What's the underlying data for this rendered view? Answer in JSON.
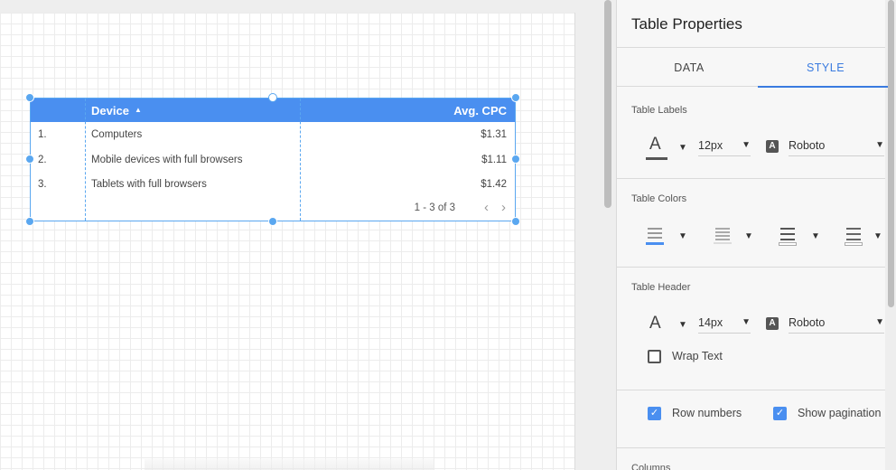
{
  "table": {
    "headers": {
      "device": "Device",
      "sort_icon": "▲",
      "cpc": "Avg. CPC"
    },
    "rows": [
      {
        "num": "1.",
        "device": "Computers",
        "cpc": "$1.31"
      },
      {
        "num": "2.",
        "device": "Mobile devices with full browsers",
        "cpc": "$1.11"
      },
      {
        "num": "3.",
        "device": "Tablets with full browsers",
        "cpc": "$1.42"
      }
    ],
    "pagination": "1 - 3 of 3",
    "prev_icon": "‹",
    "next_icon": "›"
  },
  "panel": {
    "title": "Table Properties",
    "tabs": [
      {
        "label": "DATA",
        "active": false
      },
      {
        "label": "STYLE",
        "active": true
      }
    ],
    "table_labels": {
      "title": "Table Labels",
      "font_size": "12px",
      "font_family": "Roboto"
    },
    "table_colors": {
      "title": "Table Colors"
    },
    "table_header": {
      "title": "Table Header",
      "font_size": "14px",
      "font_family": "Roboto",
      "wrap_text": "Wrap Text",
      "wrap_checked": false
    },
    "options": {
      "row_numbers": "Row numbers",
      "row_numbers_checked": true,
      "show_pagination": "Show pagination",
      "show_pagination_checked": true
    },
    "columns_title": "Columns"
  },
  "icons": {
    "caret": "▼",
    "font_glyph": "A",
    "check": "✓"
  },
  "colors": {
    "accent": "#4a8ff0",
    "selection": "#5aa7f0",
    "tab_active": "#3a7be0"
  }
}
